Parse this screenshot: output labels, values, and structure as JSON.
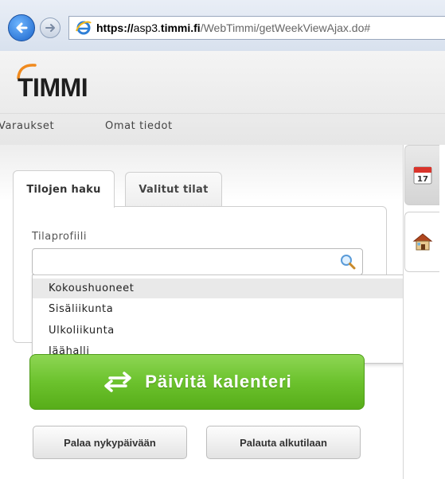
{
  "browser": {
    "url_scheme": "https://",
    "url_host_prefix": "asp3.",
    "url_host_bold": "timmi.fi",
    "url_path": "/WebTimmi/getWeekViewAjax.do#",
    "back_icon": "back-arrow-icon",
    "forward_icon": "forward-arrow-icon",
    "site_icon": "ie-icon"
  },
  "app": {
    "logo_text": "TIMMI",
    "accent_color": "#f08a1e"
  },
  "menu": {
    "items": [
      "Varaukset",
      "Omat tiedot"
    ]
  },
  "rail": {
    "calendar_day": "17",
    "icons": [
      "calendar-icon",
      "house-icon"
    ]
  },
  "tabs": [
    {
      "label": "Tilojen haku",
      "active": true
    },
    {
      "label": "Valitut tilat",
      "active": false
    }
  ],
  "search": {
    "label": "Tilaprofiili",
    "value": "",
    "icon": "search-icon"
  },
  "dropdown": {
    "options": [
      "Kokoushuoneet",
      "Sisäliikunta",
      "Ulkoliikunta",
      "Jäähalli"
    ],
    "highlighted_index": 0
  },
  "actions": {
    "refresh_label": "Päivitä kalenteri",
    "refresh_color": "#6cc22d",
    "today_label": "Palaa nykypäivään",
    "reset_label": "Palauta alkutilaan"
  }
}
